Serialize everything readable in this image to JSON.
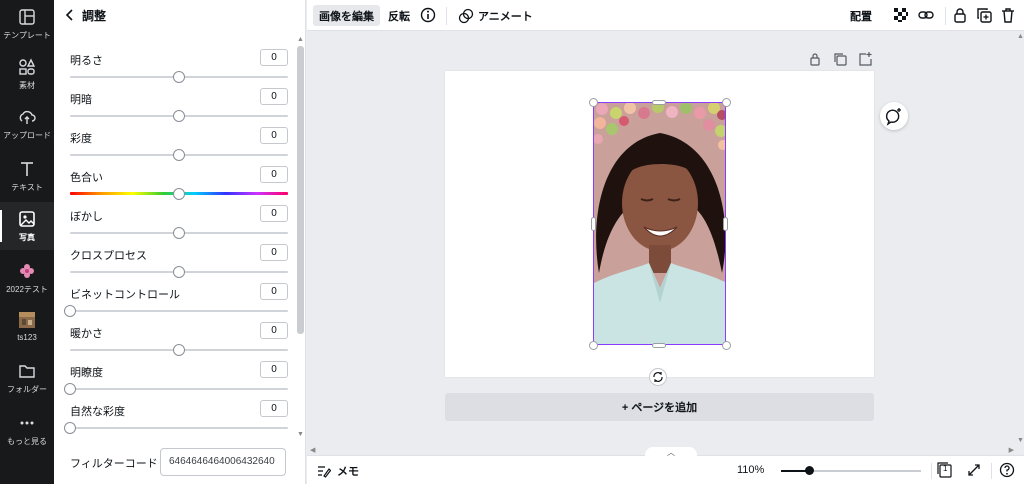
{
  "rail": {
    "items": [
      {
        "name": "rail-templates",
        "icon": "layout-icon",
        "label": "テンプレート"
      },
      {
        "name": "rail-elements",
        "icon": "shapes-icon",
        "label": "素材"
      },
      {
        "name": "rail-uploads",
        "icon": "cloud-upload-icon",
        "label": "アップロード"
      },
      {
        "name": "rail-text",
        "icon": "text-icon",
        "label": "テキスト"
      },
      {
        "name": "rail-photos",
        "icon": "image-icon",
        "label": "写真",
        "active": true
      },
      {
        "name": "rail-2022test",
        "icon": "flower-icon",
        "label": "2022テスト"
      },
      {
        "name": "rail-ts123",
        "icon": "thumbnail-icon",
        "label": "ts123"
      },
      {
        "name": "rail-folder",
        "icon": "folder-icon",
        "label": "フォルダー"
      },
      {
        "name": "rail-more",
        "icon": "more-dots-icon",
        "label": "もっと見る"
      }
    ]
  },
  "panel": {
    "title": "調整",
    "adjustments": [
      {
        "label": "明るさ",
        "value": "0",
        "level": 0.5
      },
      {
        "label": "明暗",
        "value": "0",
        "level": 0.5
      },
      {
        "label": "彩度",
        "value": "0",
        "level": 0.5
      },
      {
        "label": "色合い",
        "value": "0",
        "level": 0.5,
        "hue": true
      },
      {
        "label": "ぼかし",
        "value": "0",
        "level": 0.5
      },
      {
        "label": "クロスプロセス",
        "value": "0",
        "level": 0.5
      },
      {
        "label": "ビネットコントロール",
        "value": "0",
        "level": 0.0
      },
      {
        "label": "暖かさ",
        "value": "0",
        "level": 0.5
      },
      {
        "label": "明瞭度",
        "value": "0",
        "level": 0.0
      },
      {
        "label": "自然な彩度",
        "value": "0",
        "level": 0.0
      }
    ],
    "filter_code_label": "フィルターコード",
    "filter_code_value": "6464646464006432640"
  },
  "toolbar": {
    "edit_image": "画像を編集",
    "flip": "反転",
    "animate": "アニメート",
    "position": "配置"
  },
  "canvas": {
    "add_page": "+ ページを追加"
  },
  "bottombar": {
    "memo": "メモ",
    "zoom": "110%",
    "zoom_level": 0.2,
    "page_count": "1"
  },
  "colors": {
    "rail_bg": "#18191b",
    "selection": "#8b3dff",
    "canvas_bg": "#ebecf0"
  }
}
